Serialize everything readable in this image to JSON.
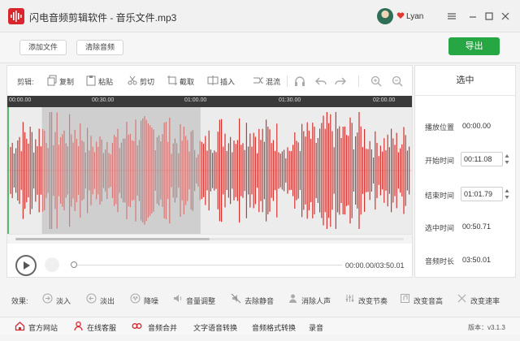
{
  "window": {
    "title": "闪电音频剪辑软件 - 音乐文件.mp3",
    "user_name": "Lyan"
  },
  "actions": {
    "add_file": "添加文件",
    "clear_audio": "清除音频",
    "export": "导出"
  },
  "toolbar": {
    "label": "剪辑:",
    "copy": "复制",
    "paste": "粘贴",
    "cut": "剪切",
    "crop": "截取",
    "insert": "插入",
    "mix": "混流"
  },
  "timeline": {
    "ticks": [
      "00:00.00",
      "00:30.00",
      "01:00.00",
      "01:30.00",
      "02:00.00"
    ],
    "scroll_thumb_fraction": 0.5
  },
  "player": {
    "time": "00:00.00/03:50.01",
    "progress": 0
  },
  "selection": {
    "panel_title": "选中",
    "play_position_label": "播放位置",
    "play_position": "00:00.00",
    "start_label": "开始时间",
    "start": "00:11.08",
    "end_label": "结束时间",
    "end": "01:01.79",
    "selected_label": "选中时间",
    "selected": "00:50.71",
    "duration_label": "音频时长",
    "duration": "03:50.01"
  },
  "effects": {
    "label": "效果:",
    "items": [
      "淡入",
      "淡出",
      "降噪",
      "音量调整",
      "去除静音",
      "消除人声",
      "改变节奏",
      "改变音高",
      "改变速率"
    ]
  },
  "bottom": {
    "website": "官方网站",
    "support": "在线客服",
    "merge": "音频合并",
    "tts": "文字语音转换",
    "format": "音频格式转换",
    "record": "录音",
    "version": "版本：v3.1.3"
  },
  "colors": {
    "accent": "#27a744",
    "brand": "#d9262c",
    "waveform": "#d2332f",
    "selection": "#cfcfcf"
  },
  "icons": {
    "logo": "waveform-logo-icon",
    "vip": "heart-badge-icon",
    "play": "play-icon"
  }
}
